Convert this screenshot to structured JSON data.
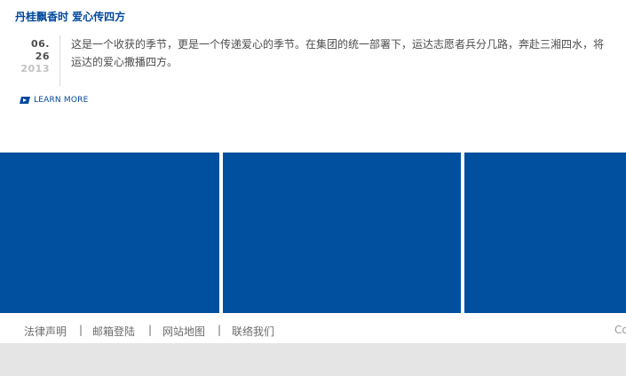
{
  "article": {
    "title": "丹桂飘香时  爱心传四方",
    "date_day": "06. 26",
    "date_year": "2013",
    "body": "这是一个收获的季节，更是一个传递爱心的季节。在集团的统一部署下，运达志愿者兵分几路，奔赴三湘四水，将运达的爱心撒播四方。",
    "learn_more": "LEARN MORE",
    "learn_more_icon": "arrow-right-icon"
  },
  "tiles": {
    "color": "#00509f"
  },
  "footer": {
    "links": [
      "法律声明",
      "邮箱登陆",
      "网站地图",
      "联络我们"
    ],
    "separator": "|",
    "copyright": "Co"
  }
}
